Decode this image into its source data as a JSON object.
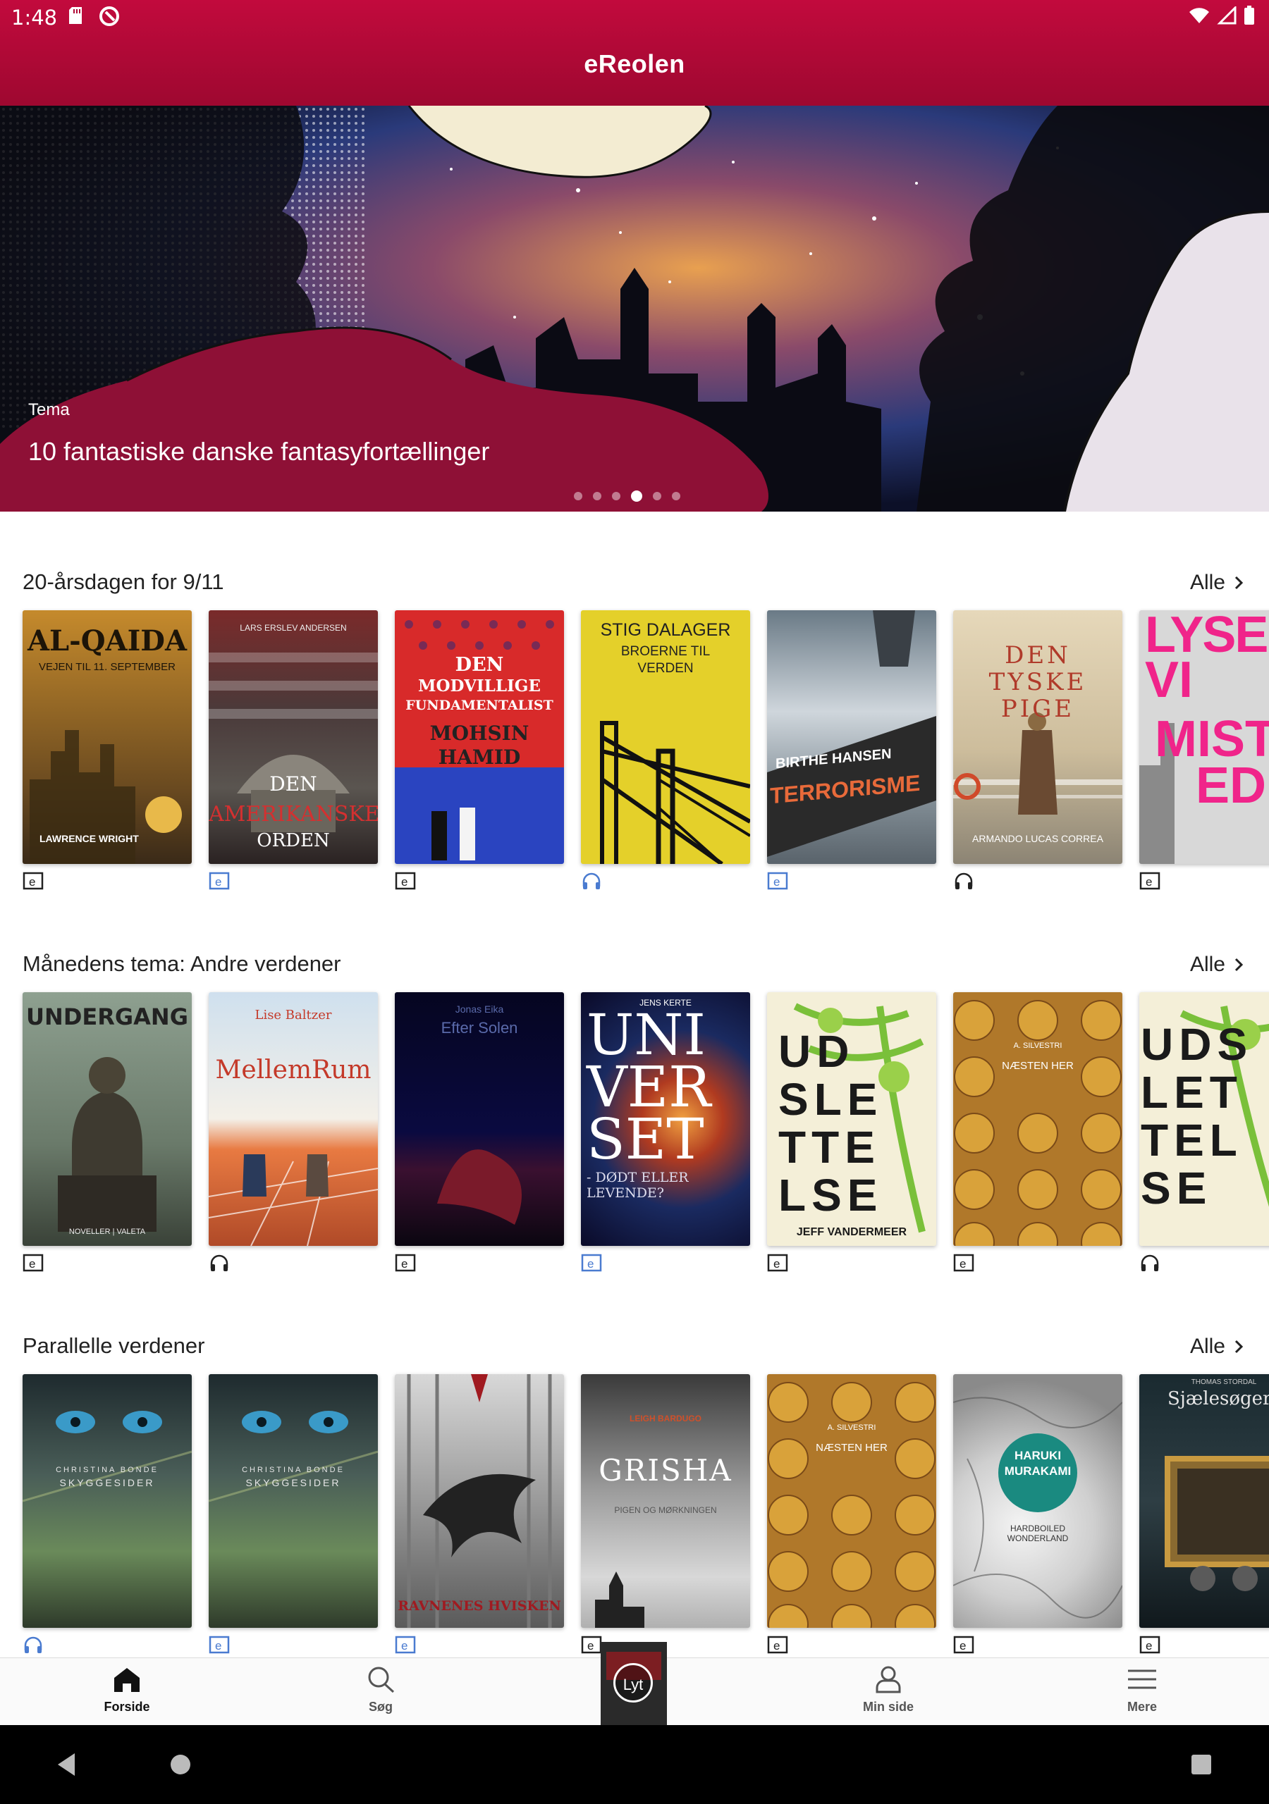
{
  "status_bar": {
    "time": "1:48"
  },
  "header": {
    "logo": "eReolen"
  },
  "hero": {
    "kicker": "Tema",
    "title": "10 fantastiske danske fantasyfortællinger",
    "dots": 6,
    "active_dot": 4
  },
  "sections": [
    {
      "title": "20-årsdagen for 9/11",
      "all_label": "Alle",
      "books": [
        {
          "lines": [
            "AL-QAIDA",
            "VEJEN TIL 11. SEPTEMBER",
            "LAWRENCE WRIGHT"
          ],
          "format": "ebook"
        },
        {
          "lines": [
            "LARS ERSLEV ANDERSEN",
            "DEN",
            "AMERIKANSKE",
            "ORDEN"
          ],
          "format": "ebook-blue"
        },
        {
          "lines": [
            "DEN",
            "MODVILLIGE",
            "FUNDAMENTALIST",
            "MOHSIN",
            "HAMID"
          ],
          "format": "ebook"
        },
        {
          "lines": [
            "STIG DALAGER",
            "BROERNE TIL",
            "VERDEN"
          ],
          "format": "audio-blue"
        },
        {
          "lines": [
            "BIRTHE HANSEN",
            "TERRORISME"
          ],
          "format": "ebook-blue"
        },
        {
          "lines": [
            "DEN",
            "TYSKE",
            "PIGE",
            "ARMANDO LUCAS CORREA"
          ],
          "format": "audio"
        },
        {
          "lines": [
            "LYSE",
            "VI",
            "MIST",
            "ED"
          ],
          "format": "ebook"
        }
      ]
    },
    {
      "title": "Månedens tema: Andre verdener",
      "all_label": "Alle",
      "books": [
        {
          "lines": [
            "UNDERGANG",
            "NOVELLER | VALETA"
          ],
          "format": "ebook"
        },
        {
          "lines": [
            "Lise Baltzer",
            "MellemRum"
          ],
          "format": "audio"
        },
        {
          "lines": [
            "Jonas Eika",
            "Efter Solen"
          ],
          "format": "ebook"
        },
        {
          "lines": [
            "JENS KERTE",
            "UNI",
            "VER",
            "SET",
            "- DØDT ELLER LEVENDE?"
          ],
          "format": "ebook-blue"
        },
        {
          "lines": [
            "UD",
            "SLE",
            "TTE",
            "LSE",
            "JEFF VANDERMEER"
          ],
          "format": "ebook"
        },
        {
          "lines": [
            "A. SILVESTRI",
            "NÆSTEN HER"
          ],
          "format": "ebook"
        },
        {
          "lines": [
            "UDS",
            "LET",
            "TEL",
            "SE"
          ],
          "format": "audio"
        }
      ]
    },
    {
      "title": "Parallelle verdener",
      "all_label": "Alle",
      "books": [
        {
          "lines": [
            "CHRISTINA BONDE",
            "SKYGGESIDER"
          ],
          "format": "audio-blue"
        },
        {
          "lines": [
            "CHRISTINA BONDE",
            "SKYGGESIDER"
          ],
          "format": "ebook-blue"
        },
        {
          "lines": [
            "RAVNENES HVISKEN"
          ],
          "format": "ebook-blue"
        },
        {
          "lines": [
            "LEIGH BARDUGO",
            "GRISHA",
            "PIGEN OG MØRKNINGEN"
          ],
          "format": "ebook"
        },
        {
          "lines": [
            "A. SILVESTRI",
            "NÆSTEN HER"
          ],
          "format": "ebook"
        },
        {
          "lines": [
            "HARUKI",
            "MURAKAMI",
            "HARDBOILED WONDERLAND"
          ],
          "format": "ebook"
        },
        {
          "lines": [
            "THOMAS STORDAL",
            "Sjælesøgerne"
          ],
          "format": "ebook"
        }
      ]
    }
  ],
  "bottom_nav": [
    {
      "label": "Forside",
      "icon": "home-icon",
      "active": true
    },
    {
      "label": "Søg",
      "icon": "search-icon",
      "active": false
    },
    {
      "label": "Min side",
      "icon": "person-icon",
      "active": false
    },
    {
      "label": "Mere",
      "icon": "menu-icon",
      "active": false
    }
  ],
  "player": {
    "label": "Lyt"
  },
  "colors": {
    "brand": "#b00a36",
    "format_blue": "#4a7bd0"
  }
}
